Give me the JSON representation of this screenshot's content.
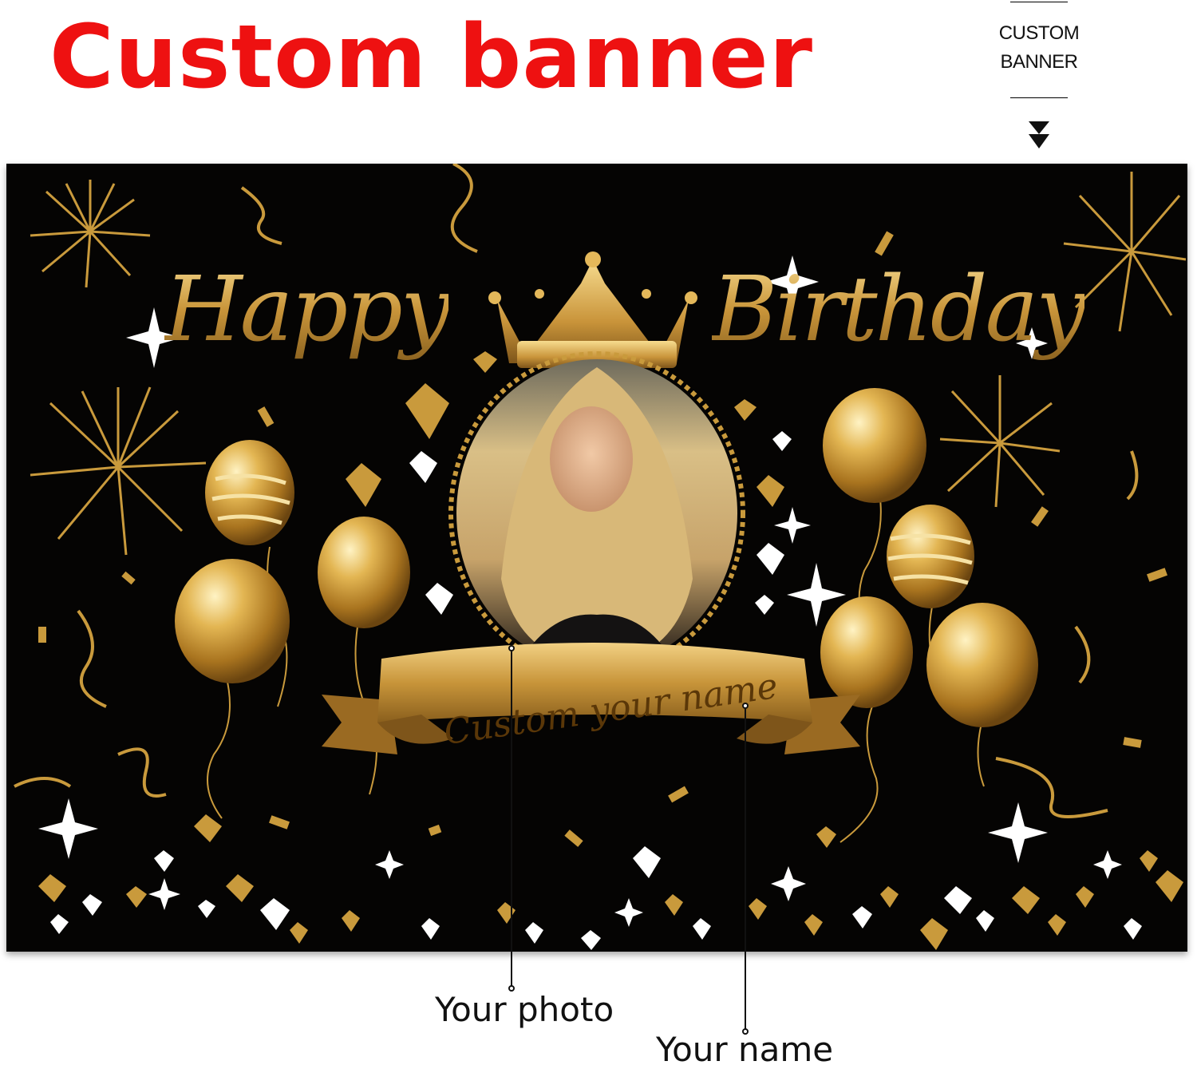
{
  "title": "Custom  banner",
  "side_tag": {
    "line1": "CUSTOM",
    "line2": "BANNER",
    "arrow_icon": "arrow-down-icon"
  },
  "banner": {
    "headline_left": "Happy",
    "headline_right": "Birthday",
    "name_text": "Custom your name",
    "background_color": "#050403",
    "accent_gold": "#d4a54a"
  },
  "callouts": [
    {
      "label": "Your photo"
    },
    {
      "label": "Your name"
    }
  ]
}
